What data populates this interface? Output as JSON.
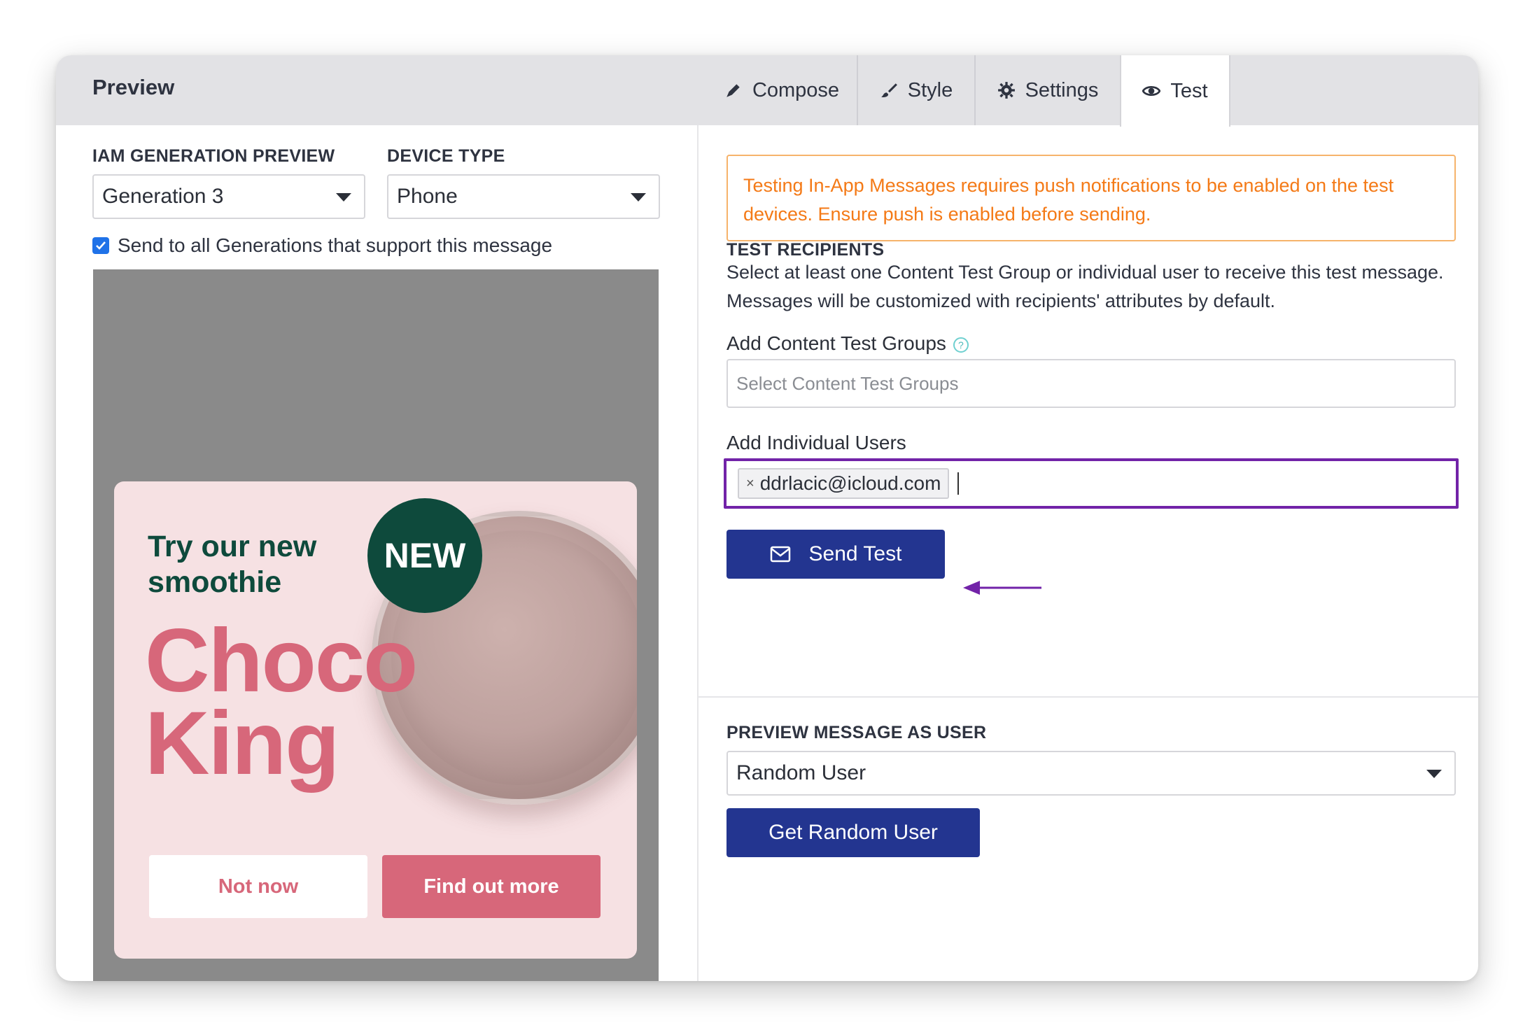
{
  "header": {
    "title": "Preview"
  },
  "tabs": [
    {
      "label": "Compose",
      "icon": "pencil-icon"
    },
    {
      "label": "Style",
      "icon": "brush-icon"
    },
    {
      "label": "Settings",
      "icon": "gear-icon"
    },
    {
      "label": "Test",
      "icon": "eye-icon",
      "active": true
    }
  ],
  "left": {
    "generation_label": "IAM GENERATION PREVIEW",
    "generation_value": "Generation 3",
    "device_label": "DEVICE TYPE",
    "device_value": "Phone",
    "send_all_label": "Send to all Generations that support this message",
    "send_all_checked": true,
    "card": {
      "badge": "NEW",
      "subtitle": "Try our new smoothie",
      "headline_line1": "Choco",
      "headline_line2": "King",
      "btn_secondary": "Not now",
      "btn_primary": "Find out more"
    }
  },
  "right": {
    "alert": "Testing In-App Messages requires push notifications to be enabled on the test devices. Ensure push is enabled before sending.",
    "recipients_title": "TEST RECIPIENTS",
    "recipients_desc": "Select at least one Content Test Group or individual user to receive this test message. Messages will be customized with recipients' attributes by default.",
    "groups_label": "Add Content Test Groups",
    "groups_help": "?",
    "groups_placeholder": "Select Content Test Groups",
    "users_label": "Add Individual Users",
    "user_tag_remove": "×",
    "user_tag": "ddrlacic@icloud.com",
    "send_test": "Send Test",
    "preview_user_title": "PREVIEW MESSAGE AS USER",
    "preview_user_value": "Random User",
    "get_random_user": "Get Random User"
  },
  "colors": {
    "primary_button": "#233590",
    "focus_outline": "#7223a8",
    "alert_text": "#f47a17",
    "alert_border": "#f6b36b",
    "card_pink": "#d7677a",
    "card_green": "#0e4a3c"
  }
}
